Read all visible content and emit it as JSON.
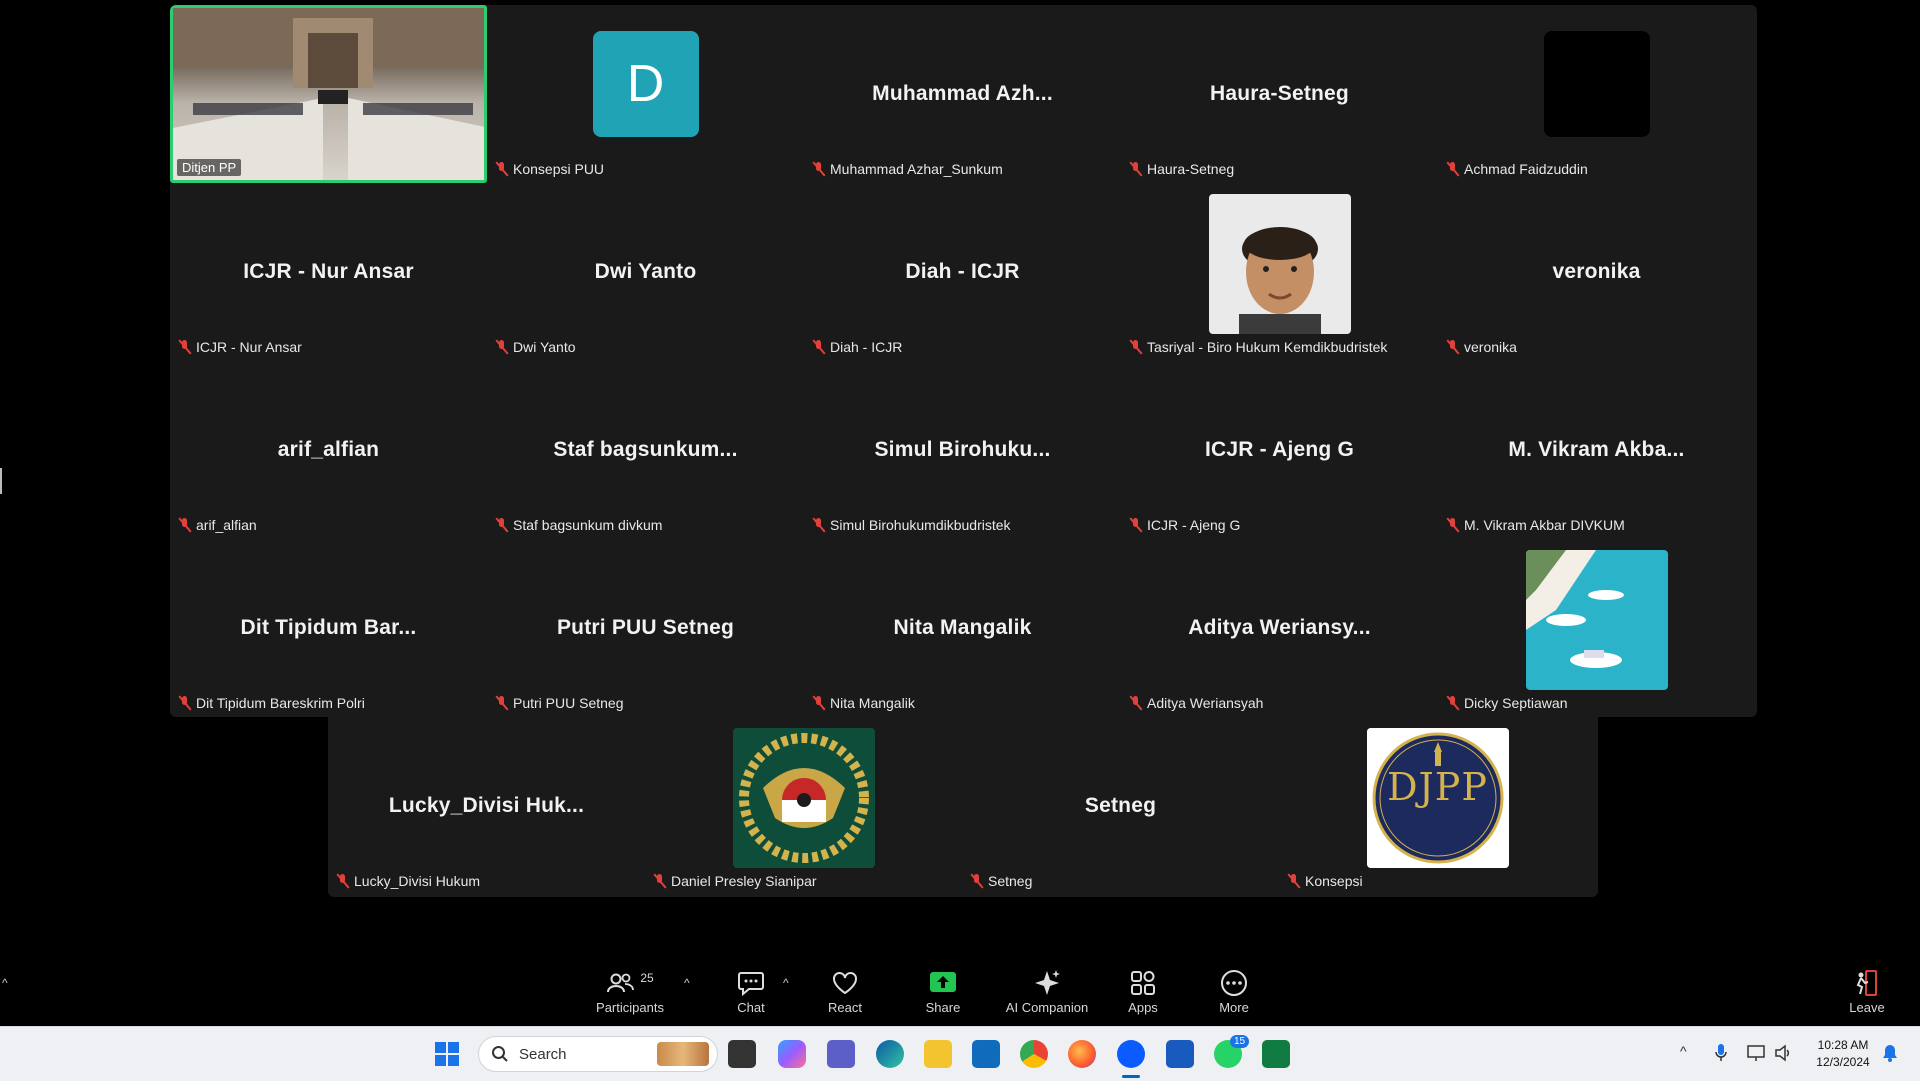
{
  "main_tiles": [
    {
      "type": "video",
      "label": "Ditjen PP",
      "active": true
    },
    {
      "type": "letter",
      "letter": "D",
      "label": "Konsepsi PUU"
    },
    {
      "type": "name",
      "center": "Muhammad Azh...",
      "label": "Muhammad Azhar_Sunkum"
    },
    {
      "type": "name",
      "center": "Haura-Setneg",
      "label": "Haura-Setneg"
    },
    {
      "type": "black",
      "label": "Achmad Faidzuddin"
    },
    {
      "type": "name",
      "center": "ICJR - Nur Ansar",
      "label": "ICJR - Nur Ansar"
    },
    {
      "type": "name",
      "center": "Dwi Yanto",
      "label": "Dwi Yanto"
    },
    {
      "type": "name",
      "center": "Diah - ICJR",
      "label": "Diah - ICJR"
    },
    {
      "type": "face",
      "label": "Tasriyal - Biro Hukum Kemdikbudristek"
    },
    {
      "type": "name",
      "center": "veronika",
      "label": "veronika"
    },
    {
      "type": "name",
      "center": "arif_alfian",
      "label": "arif_alfian"
    },
    {
      "type": "name",
      "center": "Staf  bagsunkum...",
      "label": "Staf bagsunkum divkum"
    },
    {
      "type": "name",
      "center": "Simul  Birohuku...",
      "label": "Simul Birohukumdikbudristek"
    },
    {
      "type": "name",
      "center": "ICJR - Ajeng G",
      "label": "ICJR - Ajeng G"
    },
    {
      "type": "name",
      "center": "M. Vikram  Akba...",
      "label": "M. Vikram Akbar DIVKUM"
    },
    {
      "type": "name",
      "center": "Dit  Tipidum  Bar...",
      "label": "Dit Tipidum Bareskrim Polri"
    },
    {
      "type": "name",
      "center": "Putri PUU Setneg",
      "label": "Putri PUU Setneg"
    },
    {
      "type": "name",
      "center": "Nita Mangalik",
      "label": "Nita Mangalik"
    },
    {
      "type": "name",
      "center": "Aditya  Weriansy...",
      "label": "Aditya Weriansyah"
    },
    {
      "type": "beach",
      "label": "Dicky Septiawan"
    }
  ],
  "bottom_tiles": [
    {
      "type": "name",
      "center": "Lucky_Divisi  Huk...",
      "label": "Lucky_Divisi Hukum"
    },
    {
      "type": "emblem",
      "label": "Daniel Presley Sianipar"
    },
    {
      "type": "name",
      "center": "Setneg",
      "label": "Setneg"
    },
    {
      "type": "djpp",
      "logo_text": "DJPP",
      "label": "Konsepsi"
    }
  ],
  "toolbar": {
    "participants_label": "Participants",
    "participants_count": "25",
    "chat_label": "Chat",
    "react_label": "React",
    "share_label": "Share",
    "ai_label": "AI Companion",
    "apps_label": "Apps",
    "more_label": "More",
    "leave_label": "Leave"
  },
  "taskbar": {
    "search_placeholder": "Search",
    "whatsapp_badge": "15",
    "clock_time": "10:28 AM",
    "clock_date": "12/3/2024"
  },
  "colors": {
    "active_border": "#2ecc71",
    "avatar_bg": "#1fa3b5",
    "tile_bg": "#1a1a1a",
    "mic_off": "#e0413b",
    "share_green": "#23c552"
  }
}
